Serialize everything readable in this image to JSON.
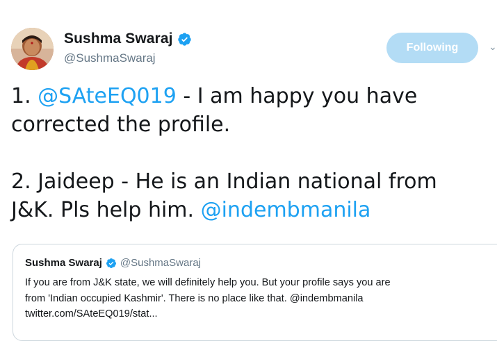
{
  "author": {
    "display_name": "Sushma Swaraj",
    "handle": "@SushmaSwaraj",
    "verified": true,
    "avatar_icon": "profile-photo"
  },
  "follow_button": {
    "label": "Following",
    "color": "#b3dcf5"
  },
  "tweet": {
    "line1": {
      "prefix": "1. ",
      "mention": "@SAteEQ019",
      "rest": " - I am happy you have"
    },
    "line2": "corrected the profile.",
    "line3": "2. Jaideep - He is an Indian national from",
    "line4": {
      "text": "J&K. Pls help him. ",
      "mention": "@indembmanila"
    }
  },
  "quoted_tweet": {
    "display_name": "Sushma Swaraj",
    "handle": "@SushmaSwaraj",
    "verified": true,
    "lines": [
      "If you are from J&K state, we will definitely help you. But your profile says you are",
      "from 'Indian occupied Kashmir'. There is no place like that. @indembmanila",
      "twitter.com/SAteEQ019/stat..."
    ]
  },
  "colors": {
    "link": "#1da1f2",
    "verified_badge": "#1da1f2",
    "secondary_text": "#657786",
    "border": "#ccd6dd"
  }
}
